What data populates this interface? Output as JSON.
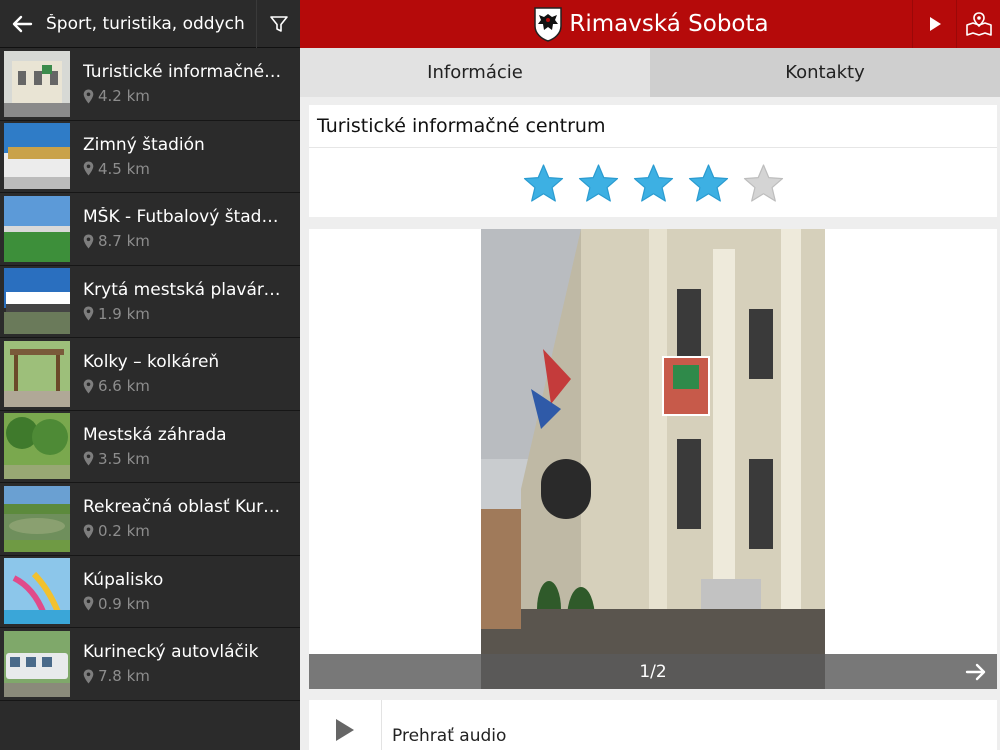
{
  "left_panel": {
    "title": "Šport, turistika, oddych",
    "items": [
      {
        "name": "Turistické informačné centrum",
        "distance": "4.2 km",
        "thumb": "building-icon"
      },
      {
        "name": "Zimný štadión",
        "distance": "4.5 km",
        "thumb": "arena-icon"
      },
      {
        "name": "MŠK - Futbalový štadión",
        "distance": "8.7 km",
        "thumb": "stadium-icon"
      },
      {
        "name": "Krytá mestská plaváreň",
        "distance": "1.9 km",
        "thumb": "pool-building-icon"
      },
      {
        "name": "Kolky – kolkáreň",
        "distance": "6.6 km",
        "thumb": "bowling-icon"
      },
      {
        "name": "Mestská záhrada",
        "distance": "3.5 km",
        "thumb": "park-icon"
      },
      {
        "name": "Rekreačná oblasť Kurinec",
        "distance": "0.2 km",
        "thumb": "lake-icon"
      },
      {
        "name": "Kúpalisko",
        "distance": "0.9 km",
        "thumb": "waterpark-icon"
      },
      {
        "name": "Kurinecký autovláčik",
        "distance": "7.8 km",
        "thumb": "train-icon"
      }
    ]
  },
  "topbar": {
    "title": "Rimavská Sobota",
    "brand_color": "#b50a0a"
  },
  "tabs": [
    {
      "label": "Informácie",
      "active": true
    },
    {
      "label": "Kontakty",
      "active": false
    }
  ],
  "detail": {
    "title": "Turistické informačné centrum",
    "rating": 4,
    "rating_max": 5,
    "star_color": "#3db0e3",
    "gallery_counter": "1/2",
    "audio_label": "Prehrať audio"
  }
}
